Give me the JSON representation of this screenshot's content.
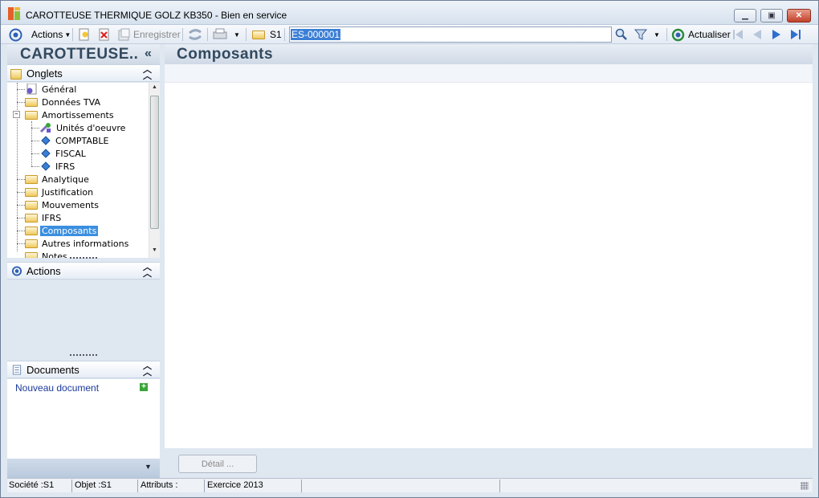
{
  "window": {
    "title": "CAROTTEUSE THERMIQUE GOLZ KB350 -  Bien en service",
    "minimize": "▁",
    "maximize": "▣",
    "close": "✕"
  },
  "toolbar": {
    "actions_label": "Actions",
    "save_label": "Enregistrer",
    "folder_label": "S1",
    "search_value": "ES-000001",
    "refresh_label": "Actualiser"
  },
  "left": {
    "title": "CAROTTEUSE..",
    "tabs_header": "Onglets",
    "tree": [
      {
        "label": "Général",
        "icon": "gear-page-icon"
      },
      {
        "label": "Données TVA",
        "icon": "folder-icon"
      },
      {
        "label": "Amortissements",
        "icon": "folder-open-icon"
      },
      {
        "label": "Unités d'oeuvre",
        "icon": "tools-icon"
      },
      {
        "label": "COMPTABLE",
        "icon": "diamond-icon"
      },
      {
        "label": "FISCAL",
        "icon": "diamond-icon"
      },
      {
        "label": "IFRS",
        "icon": "diamond-icon"
      },
      {
        "label": "Analytique",
        "icon": "folder-icon"
      },
      {
        "label": "Justification",
        "icon": "folder-icon"
      },
      {
        "label": "Mouvements",
        "icon": "folder-icon"
      },
      {
        "label": "IFRS",
        "icon": "folder-icon"
      },
      {
        "label": "Composants",
        "icon": "folder-open-icon",
        "selected": true
      },
      {
        "label": "Autres informations",
        "icon": "folder-icon"
      },
      {
        "label": "Notes",
        "icon": "folder-icon"
      }
    ],
    "actions_header": "Actions",
    "documents_header": "Documents",
    "new_document": "Nouveau document"
  },
  "main": {
    "title": "Composants",
    "detail_button": "Détail ..."
  },
  "status": {
    "societe": "Société :S1",
    "objet": "Objet :S1",
    "attributs": "Attributs :",
    "exercice": "Exercice 2013"
  }
}
